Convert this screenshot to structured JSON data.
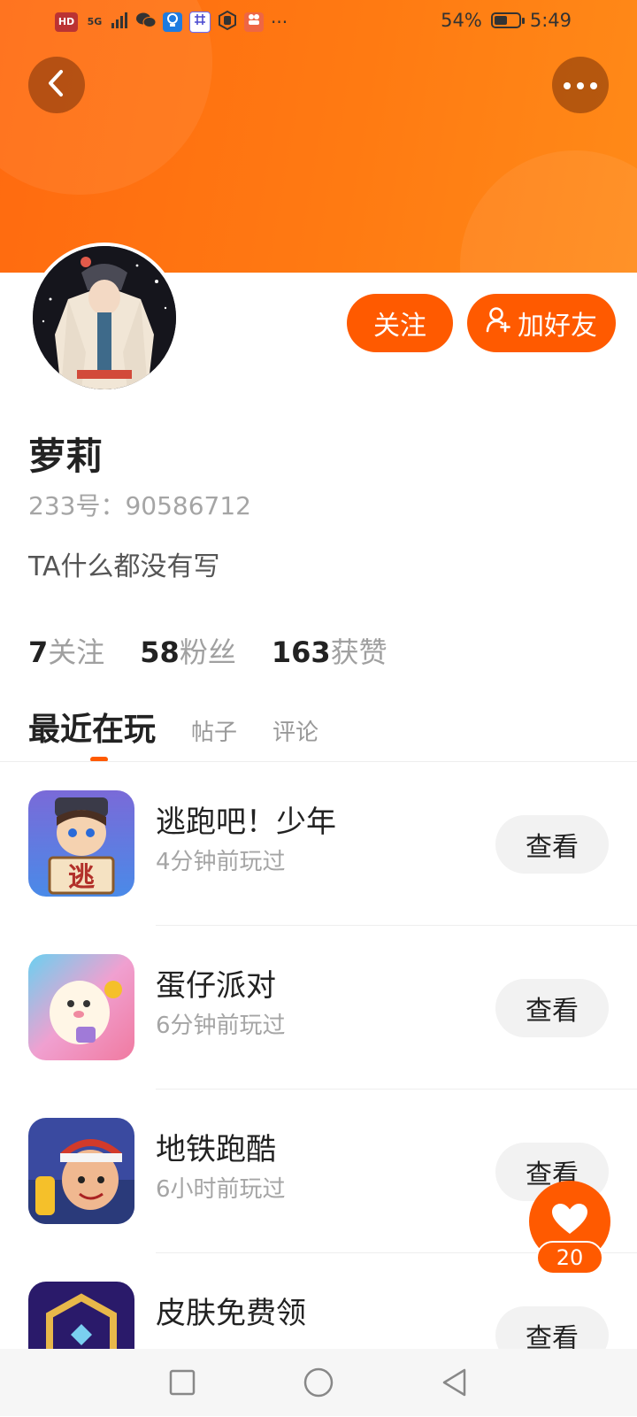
{
  "status_bar": {
    "left_items": [
      "HD",
      "5G",
      "signal-icon",
      "wechat-icon",
      "lightbulb-icon",
      "app-icon",
      "hand-icon",
      "app2-icon",
      "···"
    ],
    "battery_level": 0.54,
    "battery_text": "54%",
    "time": "5:49"
  },
  "header": {
    "back_icon": "chevron-left-icon",
    "more_icon": "more-dots-icon",
    "accent_color": "#ff6a10"
  },
  "profile": {
    "follow_label": "关注",
    "add_friend_label": "加好友",
    "name": "萝莉",
    "uid": "233号：90586712",
    "bio": "TA什么都没有写"
  },
  "stats": [
    {
      "value": "7",
      "label": "关注"
    },
    {
      "value": "58",
      "label": "粉丝"
    },
    {
      "value": "163",
      "label": "获赞"
    }
  ],
  "tabs": [
    {
      "label": "最近在玩",
      "active": true
    },
    {
      "label": "帖子",
      "active": false
    },
    {
      "label": "评论",
      "active": false
    }
  ],
  "games": [
    {
      "title": "逃跑吧！少年",
      "sub": "4分钟前玩过",
      "button": "查看",
      "icon_text": "逃"
    },
    {
      "title": "蛋仔派对",
      "sub": "6分钟前玩过",
      "button": "查看"
    },
    {
      "title": "地铁跑酷",
      "sub": "6小时前玩过",
      "button": "查看"
    },
    {
      "title": "皮肤免费领",
      "sub": "",
      "button": "查看"
    }
  ],
  "fab": {
    "icon": "heart-icon",
    "count": "20"
  },
  "nav": {
    "items": [
      "square-icon",
      "circle-icon",
      "triangle-back-icon"
    ]
  }
}
